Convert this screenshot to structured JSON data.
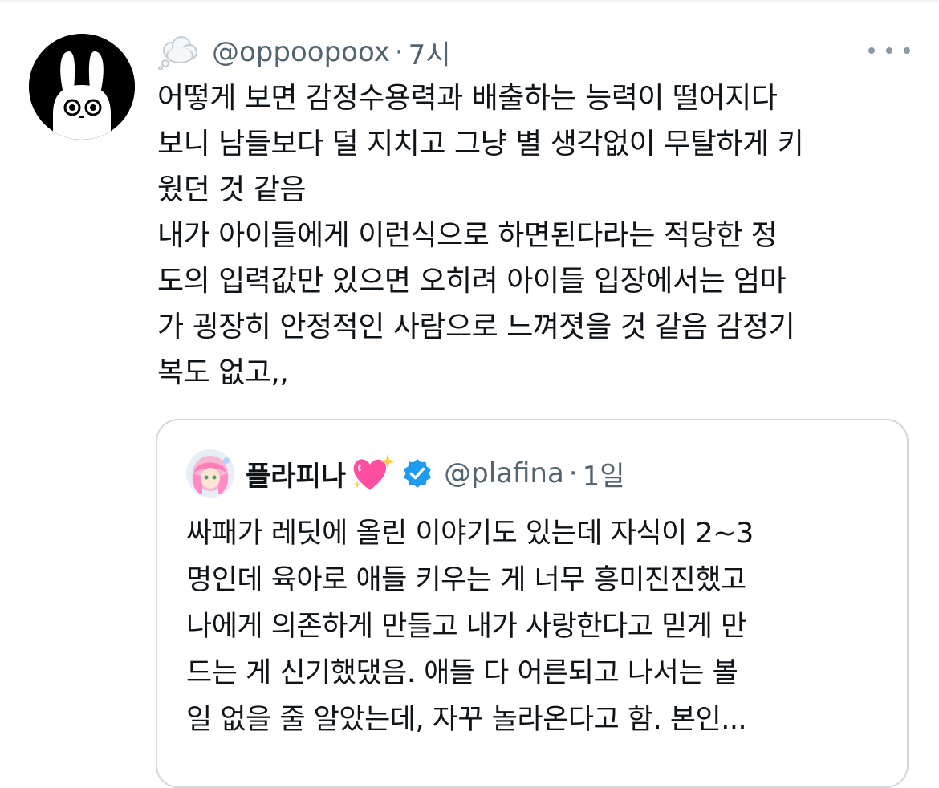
{
  "tweet": {
    "handle": "@oppoopoox",
    "separator": "·",
    "time": "7시",
    "status_emoji": "thought-balloon-icon",
    "more_icon": "more-horizontal-icon",
    "text_lines": [
      "어떻게 보면 감정수용력과 배출하는 능력이 떨어지다",
      "보니 남들보다 덜 지치고 그냥 별 생각없이 무탈하게 키",
      "웠던 것 같음",
      "내가 아이들에게 이런식으로 하면된다라는 적당한 정",
      "도의 입력값만 있으면 오히려 아이들 입장에서는 엄마",
      "가 굉장히 안정적인 사람으로 느껴졋을 것 같음 감정기",
      "복도 없고,,"
    ]
  },
  "quote": {
    "name": "플라피나",
    "name_emoji": "sparkling-heart-icon",
    "verified": true,
    "handle": "@plafina",
    "separator": "·",
    "time": "1일",
    "text_lines": [
      "싸패가 레딧에 올린 이야기도 있는데 자식이 2~3",
      "명인데 육아로 애들 키우는 게 너무 흥미진진했고",
      "나에게 의존하게 만들고 내가 사랑한다고 믿게 만",
      "드는 게 신기했댔음. 애들 다 어른되고 나서는 볼",
      "일 없을 줄 알았는데, 자꾸 놀라온다고 함. 본인..."
    ]
  },
  "colors": {
    "text": "#0f1419",
    "secondary": "#536471",
    "border": "#cfd9de",
    "verified": "#1d9bf0",
    "heart": "#ff4fa3"
  }
}
